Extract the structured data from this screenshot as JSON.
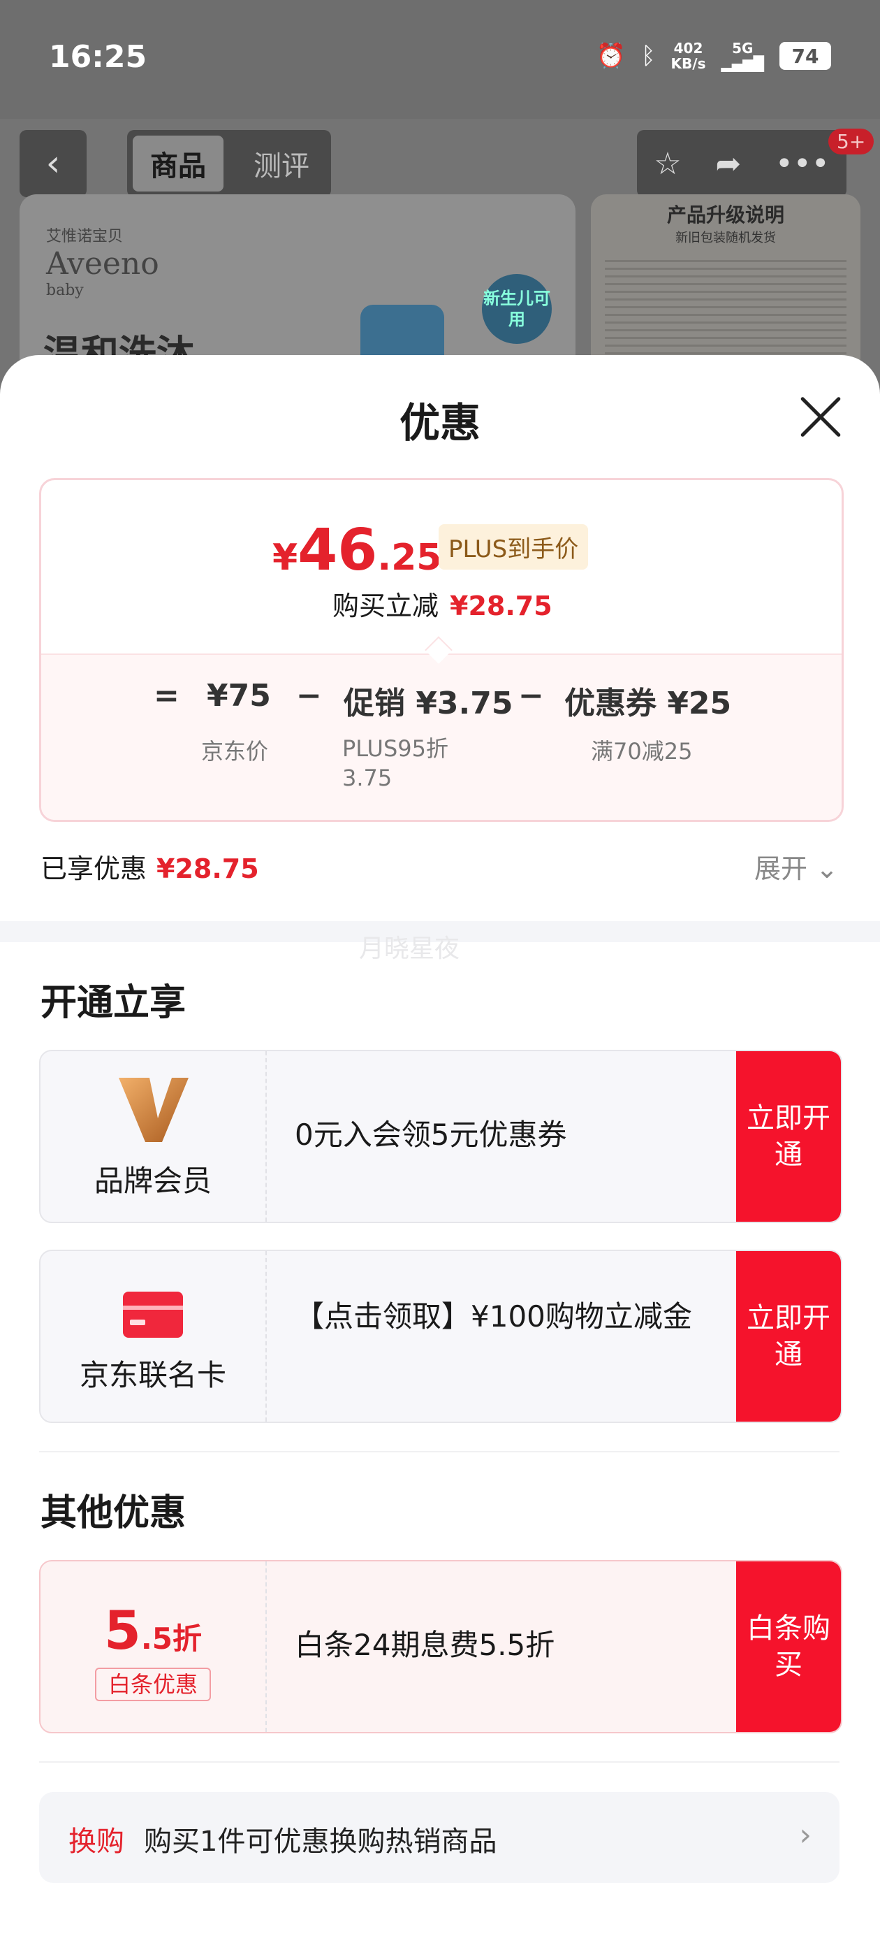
{
  "status_bar": {
    "time": "16:25",
    "alarm_icon": "alarm-icon",
    "bluetooth_icon": "bluetooth-icon",
    "net_speed": "402",
    "net_unit": "KB/s",
    "network": "5G",
    "battery": "74"
  },
  "product_page": {
    "tabs": [
      "商品",
      "测评"
    ],
    "cart_badge": "5+",
    "brand_cn": "艾惟诺宝贝",
    "brand": "Aveeno",
    "brand_sub": "baby",
    "headline": "温和洗沐",
    "newborn_badge": "新生儿可用",
    "upgrade_title": "产品升级说明",
    "upgrade_sub": "新旧包装随机发货"
  },
  "sheet": {
    "title": "优惠",
    "price_card": {
      "currency": "¥",
      "price_int": "46",
      "price_dec": ".25",
      "plus_tag": "PLUS到手价",
      "buy_reduce_label": "购买立减",
      "buy_reduce_value": "¥28.75",
      "equals": "=",
      "minus": "−",
      "jd_price": "¥75",
      "jd_price_label": "京东价",
      "promo": "促销 ¥3.75",
      "promo_label": "PLUS95折 3.75",
      "coupon": "优惠券 ¥25",
      "coupon_label": "满70减25"
    },
    "enjoyed_label": "已享优惠",
    "enjoyed_value": "¥28.75",
    "expand_label": "展开",
    "watermark": "月晓星夜",
    "open_section_title": "开通立享",
    "member_offer": {
      "label": "品牌会员",
      "desc": "0元入会领5元优惠券",
      "button": "立即开通"
    },
    "card_offer": {
      "label": "京东联名卡",
      "desc": "【点击领取】¥100购物立减金",
      "button": "立即开通"
    },
    "other_section_title": "其他优惠",
    "baitiao_offer": {
      "num_big": "5",
      "num_small": ".5折",
      "tag": "白条优惠",
      "desc": "白条24期息费5.5折",
      "button": "白条购买"
    },
    "swap": {
      "tag": "换购",
      "text": "购买1件可优惠换购热销商品"
    }
  }
}
